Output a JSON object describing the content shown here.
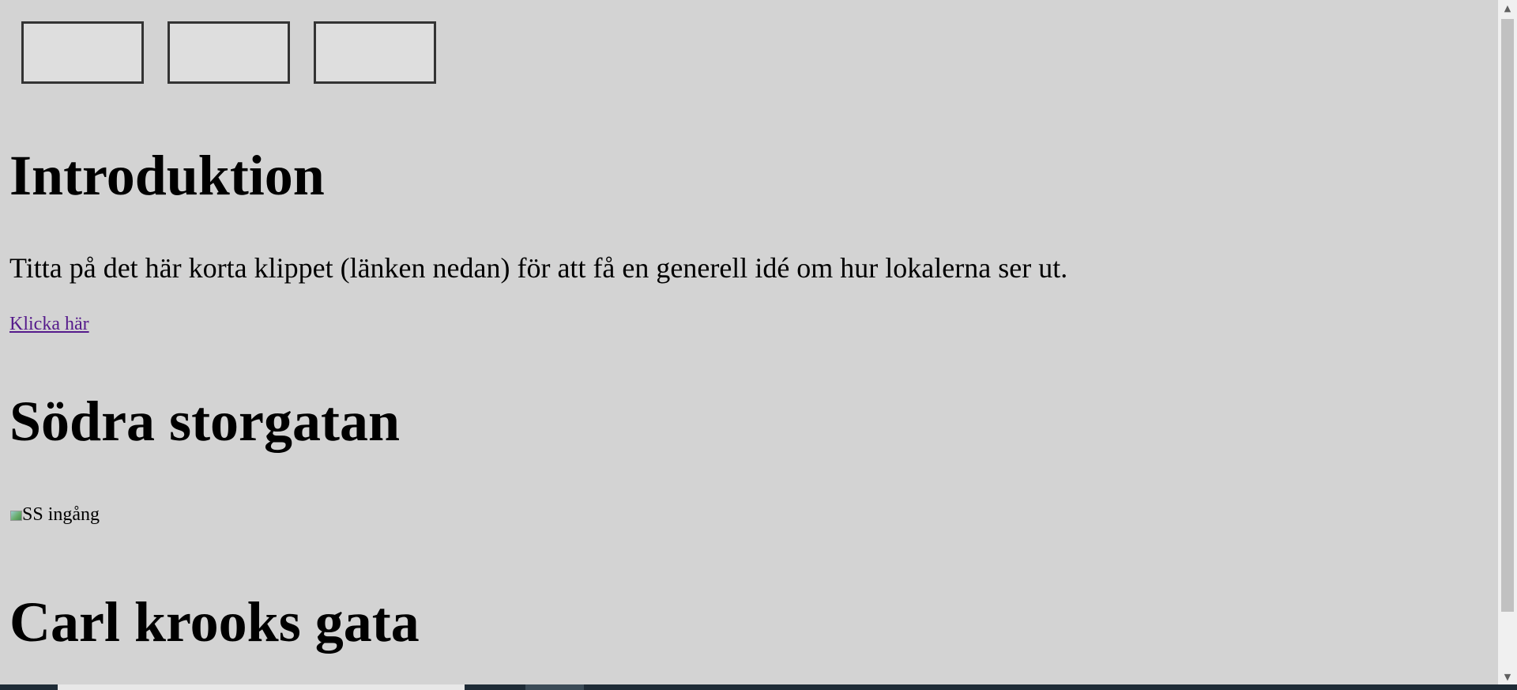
{
  "top_buttons": [
    "",
    "",
    ""
  ],
  "sections": {
    "intro_heading": "Introduktion",
    "intro_text": "Titta på det här korta klippet (länken nedan) för att få en generell idé om hur lokalerna ser ut.",
    "intro_link": "Klicka här",
    "sodra_heading": "Södra storgatan",
    "sodra_image_alt": "SS ingång",
    "carl_heading": "Carl krooks gata"
  },
  "scrollbar": {
    "up_icon": "▲",
    "down_icon": "▼"
  }
}
